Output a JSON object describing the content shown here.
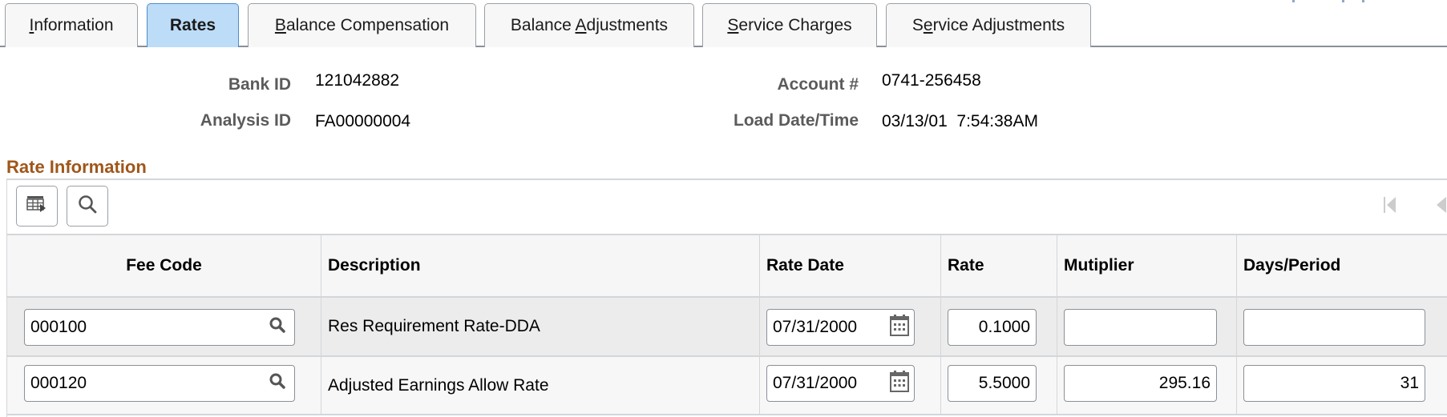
{
  "tabs": [
    {
      "label": "Information",
      "accesskey_index": 0,
      "active": false
    },
    {
      "label": "Rates",
      "accesskey_index": -1,
      "active": true
    },
    {
      "label": "Balance Compensation",
      "accesskey_index": 0,
      "active": false
    },
    {
      "label": "Balance Adjustments",
      "accesskey_index": 8,
      "active": false
    },
    {
      "label": "Service Charges",
      "accesskey_index": 0,
      "active": false
    },
    {
      "label": "Service Adjustments",
      "accesskey_index": 1,
      "active": false
    }
  ],
  "header": {
    "bank_id_label": "Bank ID",
    "bank_id": "121042882",
    "analysis_id_label": "Analysis ID",
    "analysis_id": "FA00000004",
    "account_label": "Account #",
    "account": "0741-256458",
    "load_datetime_label": "Load Date/Time",
    "load_datetime": "03/13/01  7:54:38AM"
  },
  "section": {
    "title": "Rate Information",
    "toolbar": {
      "personalize_icon": "grid-settings-icon",
      "find_icon": "search-icon",
      "first_icon": "first-page-icon",
      "prev_icon": "previous-page-icon"
    }
  },
  "table": {
    "columns": [
      "Fee Code",
      "Description",
      "Rate Date",
      "Rate",
      "Mutiplier",
      "Days/Period"
    ],
    "rows": [
      {
        "fee_code": "000100",
        "description": "Res Requirement Rate-DDA",
        "rate_date": "07/31/2000",
        "rate": "0.1000",
        "multiplier": "",
        "days_period": ""
      },
      {
        "fee_code": "000120",
        "description": "Adjusted Earnings Allow Rate",
        "rate_date": "07/31/2000",
        "rate": "5.5000",
        "multiplier": "295.16",
        "days_period": "31"
      }
    ]
  },
  "colors": {
    "active_tab": "#bddcf8",
    "section_title": "#a0561a",
    "label_gray": "#5b5b5b"
  }
}
